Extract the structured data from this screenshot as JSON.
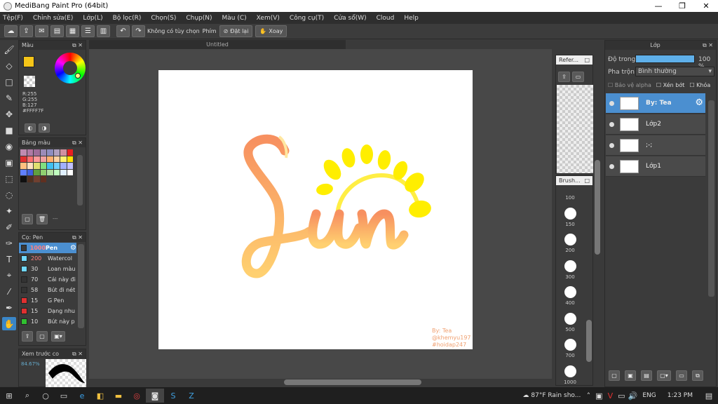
{
  "window": {
    "title": "MediBang Paint Pro (64bit)",
    "min": "—",
    "max": "❐",
    "close": "✕"
  },
  "menu": [
    "Tệp(F)",
    "Chỉnh sửa(E)",
    "Lớp(L)",
    "Bộ lọc(R)",
    "Chọn(S)",
    "Chụp(N)",
    "Màu (C)",
    "Xem(V)",
    "Công cụ(T)",
    "Cửa sổ(W)",
    "Cloud",
    "Help"
  ],
  "toolbar": {
    "no_options": "Không có tùy chọn",
    "keys_label": "Phím",
    "reset_label": "Đặt lại",
    "rotate_label": "Xoay"
  },
  "canvas": {
    "tab_title": "Untitled"
  },
  "color_panel": {
    "title": "Màu",
    "r": "R:255",
    "g": "G:255",
    "b": "B:127",
    "hex": "#FFFF7F",
    "primary": "#f5c518",
    "secondary": "#ffffff"
  },
  "palette_panel": {
    "title": "Bảng màu",
    "dash": "---",
    "swatches": [
      "#c08bb0",
      "#b07aa5",
      "#a06d9a",
      "#9b8bb8",
      "#8e8ec0",
      "#b0a0c0",
      "#d090a0",
      "#e82020",
      "#e03030",
      "#ff7070",
      "#ff9a9a",
      "#f0a0a0",
      "#ffb070",
      "#ffd0a0",
      "#fff070",
      "#ffe000",
      "#ffc080",
      "#ffe0c0",
      "#e0e070",
      "#80e080",
      "#40c0f0",
      "#70d0ff",
      "#a0b0ff",
      "#c0c0ff",
      "#6080ff",
      "#4060e0",
      "#60a040",
      "#90d070",
      "#b0e0a0",
      "#c0ffc0",
      "#e0f0ff",
      "#ffffff",
      "#101010",
      "#503020",
      "#704030",
      "#603020"
    ]
  },
  "brush_panel": {
    "title": "Cọ: Pen",
    "items": [
      {
        "size": "1000",
        "name": "Pen",
        "color": "#3a3a3a"
      },
      {
        "size": "200",
        "name": "Watercol",
        "color": "#70d8ff"
      },
      {
        "size": "30",
        "name": "Loan màu",
        "color": "#70d8ff"
      },
      {
        "size": "70",
        "name": "Cái này đi",
        "color": "#333"
      },
      {
        "size": "58",
        "name": "Bút đi nét",
        "color": "#333"
      },
      {
        "size": "15",
        "name": "G Pen",
        "color": "#e03030"
      },
      {
        "size": "15",
        "name": "Dạng nhu",
        "color": "#e03030"
      },
      {
        "size": "10",
        "name": "Bút này p",
        "color": "#30c030"
      }
    ]
  },
  "preview_panel": {
    "title": "Xem trước co",
    "zoom": "84.67%"
  },
  "reference_panel": {
    "title": "Refer..."
  },
  "brush_size_panel": {
    "title": "Brush...",
    "sizes": [
      "100",
      "150",
      "200",
      "300",
      "400",
      "500",
      "700",
      "1000"
    ]
  },
  "layer_panel": {
    "title": "Lớp",
    "opacity_label": "Độ trong",
    "opacity_value": "100 %",
    "opacity_fraction": 1.0,
    "blend_label": "Pha trộn",
    "blend_value": "Bình thường",
    "protect_alpha": "Bảo vệ alpha",
    "clip": "Xén bớt",
    "lock": "Khóa",
    "layers": [
      {
        "name": "By: Tea",
        "selected": true
      },
      {
        "name": "Lớp2",
        "selected": false
      },
      {
        "name": ";-;",
        "selected": false
      },
      {
        "name": "Lớp1",
        "selected": false
      }
    ]
  },
  "artwork": {
    "watermark_line1": "By: Tea",
    "watermark_line2": "@khemyu197",
    "watermark_line3": "#hoidap247",
    "sun_color": "#ffee00",
    "text_color": "#f7a96b"
  },
  "taskbar": {
    "weather": "87°F  Rain sho...",
    "lang": "ENG",
    "time": "1:23 PM"
  }
}
